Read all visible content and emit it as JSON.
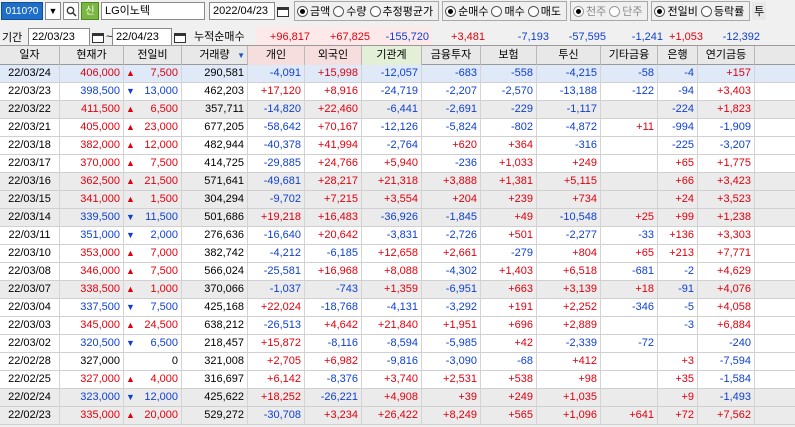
{
  "toolbar": {
    "screen_code": "0110?0",
    "stock_name": "LG이노텍",
    "shin_label": "신",
    "date": "2022/04/23",
    "mode_options": [
      {
        "label": "금액",
        "checked": true
      },
      {
        "label": "수량",
        "checked": false
      },
      {
        "label": "추정평균가",
        "checked": false
      }
    ],
    "type_options": [
      {
        "label": "순매수",
        "checked": true
      },
      {
        "label": "매수",
        "checked": false
      },
      {
        "label": "매도",
        "checked": false
      }
    ],
    "unit_options": [
      {
        "label": "천주",
        "checked": true,
        "disabled": true
      },
      {
        "label": "단주",
        "checked": false,
        "disabled": true
      }
    ],
    "compare_options": [
      {
        "label": "전일비",
        "checked": true
      },
      {
        "label": "등락률",
        "checked": false
      }
    ],
    "extra_label": "투"
  },
  "period": {
    "label": "기간",
    "start": "22/03/23",
    "end": "22/04/23",
    "sum_label": "누적순매수",
    "sums": [
      "+96,817",
      "+67,825",
      "-155,720",
      "+3,481",
      "-7,193",
      "-57,595",
      "-1,241",
      "+1,053",
      "-12,392"
    ]
  },
  "columns": [
    "일자",
    "현재가",
    "전일비",
    "거래량",
    "개인",
    "외국인",
    "기관계",
    "금융투자",
    "보험",
    "투신",
    "기타금융",
    "은행",
    "연기금등"
  ],
  "rows": [
    {
      "date": "22/03/24",
      "price": "406,000",
      "dir": "up",
      "chg": "7,500",
      "vol": "290,581",
      "ind": "-4,091",
      "frn": "+15,998",
      "inst": "-12,057",
      "fin": "-683",
      "ins": "-558",
      "trust": "-4,215",
      "etc": "-58",
      "bank": "-4",
      "pen": "+157",
      "style": "sel"
    },
    {
      "date": "22/03/23",
      "price": "398,500",
      "dir": "down",
      "chg": "13,000",
      "vol": "462,203",
      "ind": "+17,120",
      "frn": "+8,916",
      "inst": "-24,719",
      "fin": "-2,207",
      "ins": "-2,570",
      "trust": "-13,188",
      "etc": "-122",
      "bank": "-94",
      "pen": "+3,403",
      "style": ""
    },
    {
      "date": "22/03/22",
      "price": "411,500",
      "dir": "up",
      "chg": "6,500",
      "vol": "357,711",
      "ind": "-14,820",
      "frn": "+22,460",
      "inst": "-6,441",
      "fin": "-2,691",
      "ins": "-229",
      "trust": "-1,117",
      "etc": "",
      "bank": "-224",
      "pen": "+1,823",
      "style": "shade"
    },
    {
      "date": "22/03/21",
      "price": "405,000",
      "dir": "up",
      "chg": "23,000",
      "vol": "677,205",
      "ind": "-58,642",
      "frn": "+70,167",
      "inst": "-12,126",
      "fin": "-5,824",
      "ins": "-802",
      "trust": "-4,872",
      "etc": "+11",
      "bank": "-994",
      "pen": "-1,909",
      "style": ""
    },
    {
      "date": "22/03/18",
      "price": "382,000",
      "dir": "up",
      "chg": "12,000",
      "vol": "482,944",
      "ind": "-40,378",
      "frn": "+41,994",
      "inst": "-2,764",
      "fin": "+620",
      "ins": "+364",
      "trust": "-316",
      "etc": "",
      "bank": "-225",
      "pen": "-3,207",
      "style": ""
    },
    {
      "date": "22/03/17",
      "price": "370,000",
      "dir": "up",
      "chg": "7,500",
      "vol": "414,725",
      "ind": "-29,885",
      "frn": "+24,766",
      "inst": "+5,940",
      "fin": "-236",
      "ins": "+1,033",
      "trust": "+249",
      "etc": "",
      "bank": "+65",
      "pen": "+1,775",
      "style": ""
    },
    {
      "date": "22/03/16",
      "price": "362,500",
      "dir": "up",
      "chg": "21,500",
      "vol": "571,641",
      "ind": "-49,681",
      "frn": "+28,217",
      "inst": "+21,318",
      "fin": "+3,888",
      "ins": "+1,381",
      "trust": "+5,115",
      "etc": "",
      "bank": "+66",
      "pen": "+3,423",
      "style": "shade"
    },
    {
      "date": "22/03/15",
      "price": "341,000",
      "dir": "up",
      "chg": "1,500",
      "vol": "304,294",
      "ind": "-9,702",
      "frn": "+7,215",
      "inst": "+3,554",
      "fin": "+204",
      "ins": "+239",
      "trust": "+734",
      "etc": "",
      "bank": "+24",
      "pen": "+3,523",
      "style": "shade"
    },
    {
      "date": "22/03/14",
      "price": "339,500",
      "dir": "down",
      "chg": "11,500",
      "vol": "501,686",
      "ind": "+19,218",
      "frn": "+16,483",
      "inst": "-36,926",
      "fin": "-1,845",
      "ins": "+49",
      "trust": "-10,548",
      "etc": "+25",
      "bank": "+99",
      "pen": "+1,238",
      "style": "shade"
    },
    {
      "date": "22/03/11",
      "price": "351,000",
      "dir": "down",
      "chg": "2,000",
      "vol": "276,636",
      "ind": "-16,640",
      "frn": "+20,642",
      "inst": "-3,831",
      "fin": "-2,726",
      "ins": "+501",
      "trust": "-2,277",
      "etc": "-33",
      "bank": "+136",
      "pen": "+3,303",
      "style": ""
    },
    {
      "date": "22/03/10",
      "price": "353,000",
      "dir": "up",
      "chg": "7,000",
      "vol": "382,742",
      "ind": "-4,212",
      "frn": "-6,185",
      "inst": "+12,658",
      "fin": "+2,661",
      "ins": "-279",
      "trust": "+804",
      "etc": "+65",
      "bank": "+213",
      "pen": "+7,771",
      "style": ""
    },
    {
      "date": "22/03/08",
      "price": "346,000",
      "dir": "up",
      "chg": "7,500",
      "vol": "566,024",
      "ind": "-25,581",
      "frn": "+16,968",
      "inst": "+8,088",
      "fin": "-4,302",
      "ins": "+1,403",
      "trust": "+6,518",
      "etc": "-681",
      "bank": "-2",
      "pen": "+4,629",
      "style": ""
    },
    {
      "date": "22/03/07",
      "price": "338,500",
      "dir": "up",
      "chg": "1,000",
      "vol": "370,066",
      "ind": "-1,037",
      "frn": "-743",
      "inst": "+1,359",
      "fin": "-6,951",
      "ins": "+663",
      "trust": "+3,139",
      "etc": "+18",
      "bank": "-91",
      "pen": "+4,076",
      "style": "shade"
    },
    {
      "date": "22/03/04",
      "price": "337,500",
      "dir": "down",
      "chg": "7,500",
      "vol": "425,168",
      "ind": "+22,024",
      "frn": "-18,768",
      "inst": "-4,131",
      "fin": "-3,292",
      "ins": "+191",
      "trust": "+2,252",
      "etc": "-346",
      "bank": "-5",
      "pen": "+4,058",
      "style": ""
    },
    {
      "date": "22/03/03",
      "price": "345,000",
      "dir": "up",
      "chg": "24,500",
      "vol": "638,212",
      "ind": "-26,513",
      "frn": "+4,642",
      "inst": "+21,840",
      "fin": "+1,951",
      "ins": "+696",
      "trust": "+2,889",
      "etc": "",
      "bank": "-3",
      "pen": "+6,884",
      "style": ""
    },
    {
      "date": "22/03/02",
      "price": "320,500",
      "dir": "down",
      "chg": "6,500",
      "vol": "218,457",
      "ind": "+15,872",
      "frn": "-8,116",
      "inst": "-8,594",
      "fin": "-5,985",
      "ins": "+42",
      "trust": "-2,339",
      "etc": "-72",
      "bank": "",
      "pen": "-240",
      "style": ""
    },
    {
      "date": "22/02/28",
      "price": "327,000",
      "dir": "none",
      "chg": "0",
      "vol": "321,008",
      "ind": "+2,705",
      "frn": "+6,982",
      "inst": "-9,816",
      "fin": "-3,090",
      "ins": "-68",
      "trust": "+412",
      "etc": "",
      "bank": "+3",
      "pen": "-7,594",
      "style": ""
    },
    {
      "date": "22/02/25",
      "price": "327,000",
      "dir": "up",
      "chg": "4,000",
      "vol": "316,697",
      "ind": "+6,142",
      "frn": "-8,376",
      "inst": "+3,740",
      "fin": "+2,531",
      "ins": "+538",
      "trust": "+98",
      "etc": "",
      "bank": "+35",
      "pen": "-1,584",
      "style": ""
    },
    {
      "date": "22/02/24",
      "price": "323,000",
      "dir": "down",
      "chg": "12,000",
      "vol": "425,622",
      "ind": "+18,252",
      "frn": "-26,221",
      "inst": "+4,908",
      "fin": "+39",
      "ins": "+249",
      "trust": "+1,035",
      "etc": "",
      "bank": "+9",
      "pen": "-1,493",
      "style": "shade"
    },
    {
      "date": "22/02/23",
      "price": "335,000",
      "dir": "up",
      "chg": "20,000",
      "vol": "529,272",
      "ind": "-30,708",
      "frn": "+3,234",
      "inst": "+26,422",
      "fin": "+8,249",
      "ins": "+565",
      "trust": "+1,096",
      "etc": "+641",
      "bank": "+72",
      "pen": "+7,562",
      "style": "shade"
    }
  ]
}
